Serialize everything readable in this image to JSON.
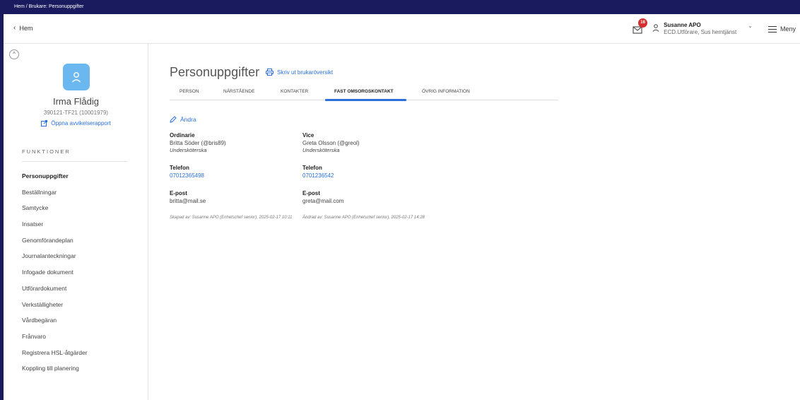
{
  "titlebar": {
    "breadcrumb": "Hem / Brukare: Personuppgifter"
  },
  "topbar": {
    "back_label": "Hem",
    "mail_count": "16",
    "user_name": "Susanne APO",
    "user_role": "ECD.Utförare, Sus hemtjänst",
    "menu_label": "Meny"
  },
  "sidebar": {
    "person_name": "Irma Flådig",
    "person_id": "390121-TF21 (10001979)",
    "report_link": "Öppna avvikelserapport",
    "section_title": "FUNKTIONER",
    "items": [
      "Personuppgifter",
      "Beställningar",
      "Samtycke",
      "Insatser",
      "Genomförandeplan",
      "Journalanteckningar",
      "Infogade dokument",
      "Utförardokument",
      "Verkställigheter",
      "Vårdbegäran",
      "Frånvaro",
      "Registrera HSL-åtgärder",
      "Koppling till planering"
    ]
  },
  "main": {
    "title": "Personuppgifter",
    "print_link": "Skriv ut brukaröversikt",
    "tabs": [
      "PERSON",
      "NÄRSTÅENDE",
      "KONTAKTER",
      "FAST OMSORGSKONTAKT",
      "ÖVRIG INFORMATION"
    ],
    "edit_label": "Ändra",
    "ordinarie": {
      "label": "Ordinarie",
      "name": "Britta Söder (@bris89)",
      "title": "Undersköterska",
      "phone_label": "Telefon",
      "phone": "07012365498",
      "email_label": "E-post",
      "email": "britta@mail.se",
      "meta": "Skapad av: Susanne APO (Enhetschef senior), 2025-02-17 10:11"
    },
    "vice": {
      "label": "Vice",
      "name": "Greta Olsson (@greol)",
      "title": "Undersköterska",
      "phone_label": "Telefon",
      "phone": "0701236542",
      "email_label": "E-post",
      "email": "greta@mail.com",
      "meta": "Ändrad av: Susanne APO (Enhetschef senior), 2025-02-17 14:28"
    }
  },
  "colors": {
    "accent": "#2a6fdb",
    "navy": "#1a1a5e",
    "avatar": "#6ab8ef",
    "badge": "#d32f2f"
  }
}
